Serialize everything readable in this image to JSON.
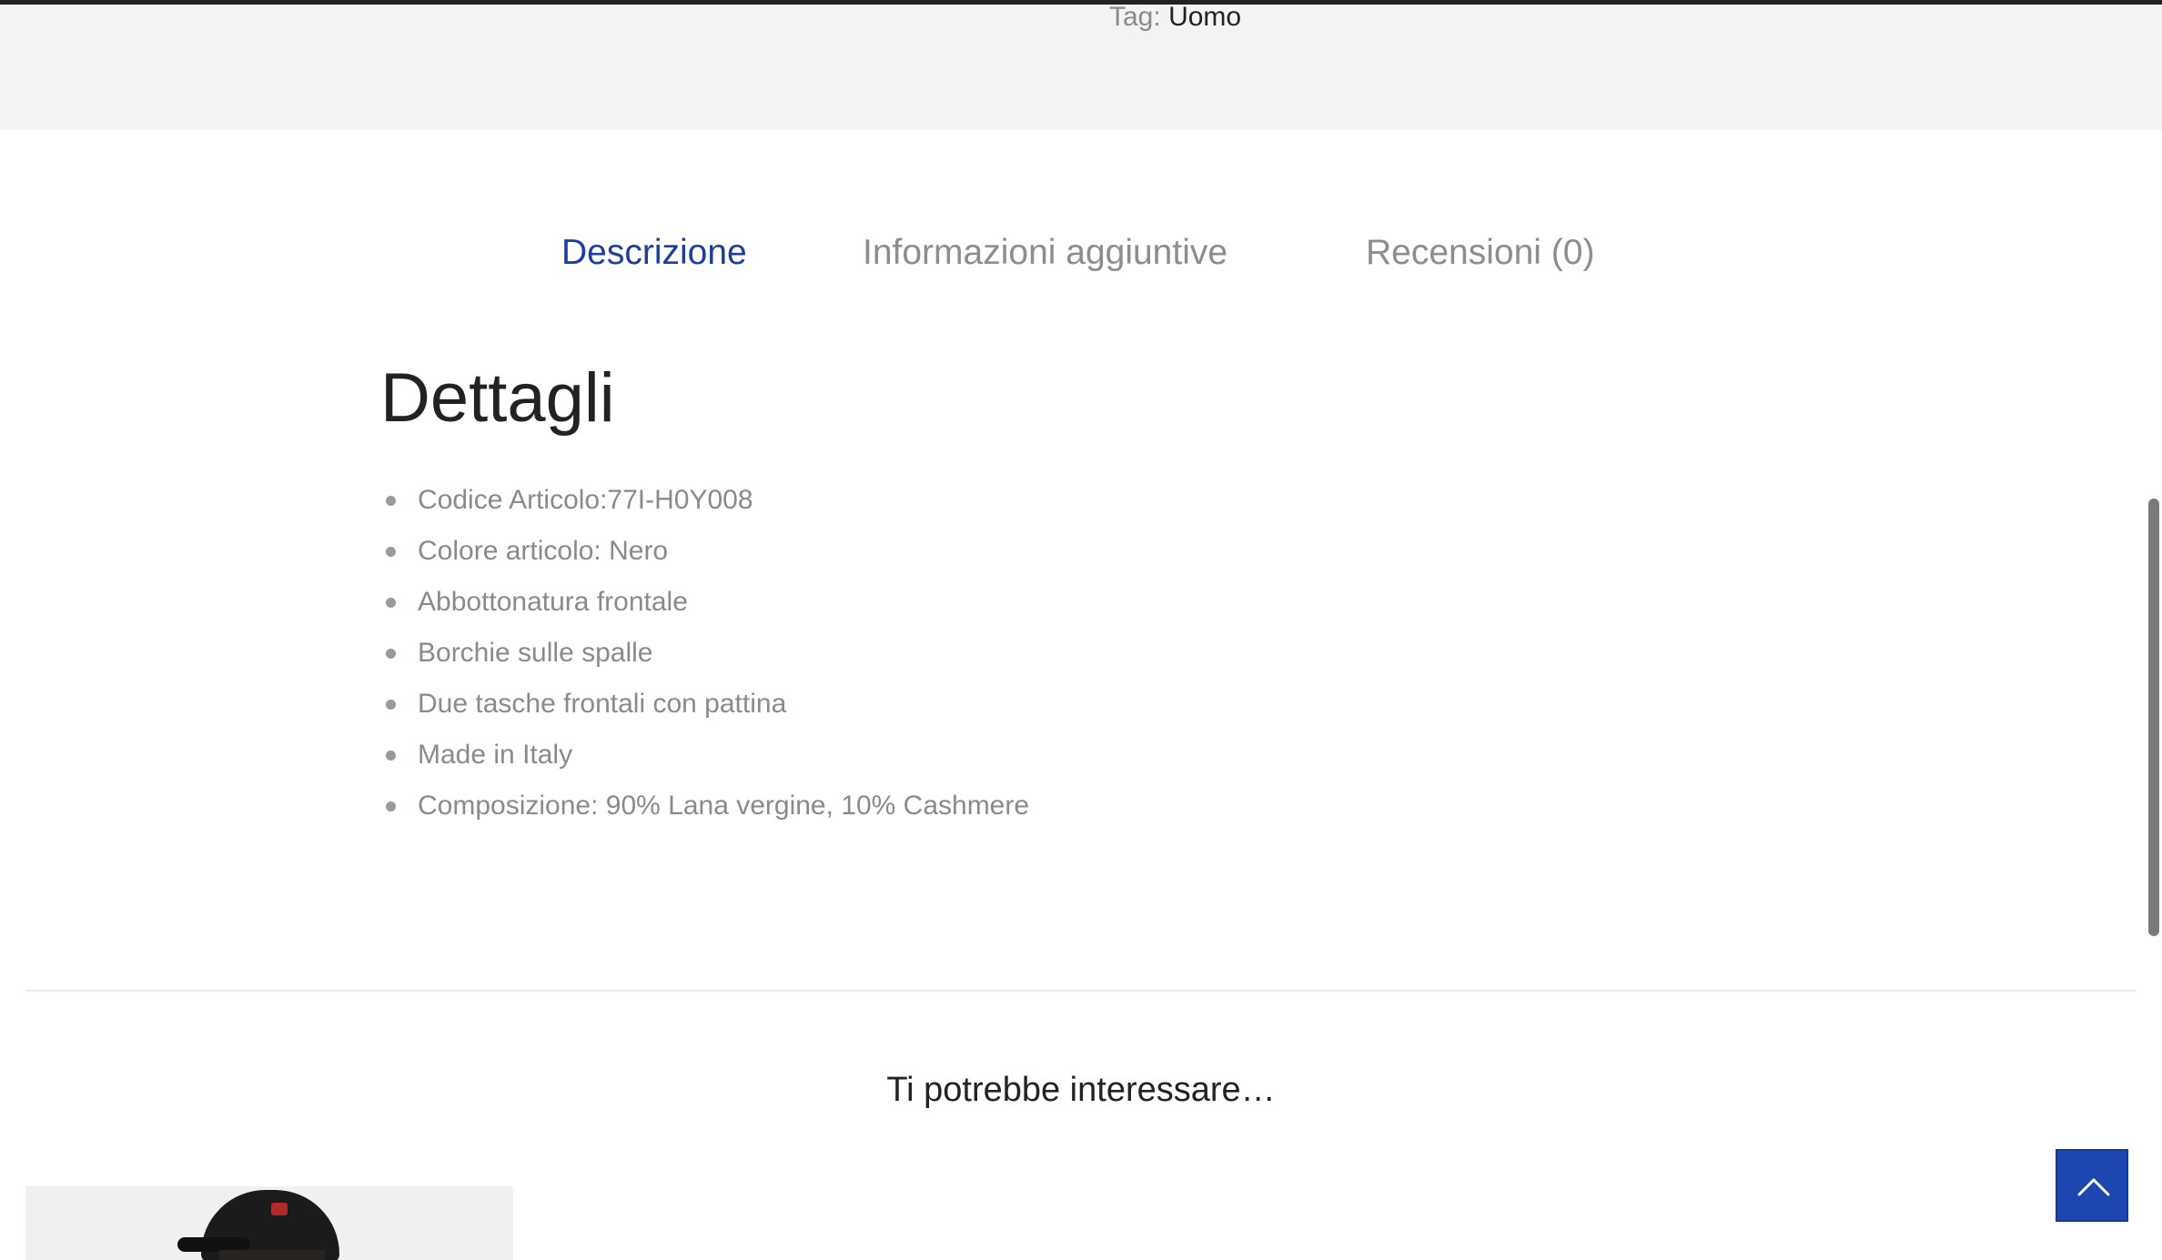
{
  "meta": {
    "tag_label": "Tag:",
    "tag_value": "Uomo"
  },
  "tabs": [
    {
      "label": "Descrizione",
      "active": true
    },
    {
      "label": "Informazioni aggiuntive",
      "active": false
    },
    {
      "label": "Recensioni (0)",
      "active": false
    }
  ],
  "description": {
    "title": "Dettagli",
    "items": [
      "Codice Articolo:77I-H0Y008",
      "Colore articolo: Nero",
      "Abbottonatura frontale",
      "Borchie sulle spalle",
      "Due tasche frontali con pattina",
      "Made in Italy",
      "Composizione: 90% Lana vergine, 10% Cashmere"
    ]
  },
  "related": {
    "title": "Ti potrebbe interessare…"
  },
  "icons": {
    "back_to_top": "chevron-up-icon",
    "bullet": "bullet-dot-icon"
  },
  "colors": {
    "accent": "#1d3f9c",
    "back_to_top_bg": "#1d46b0",
    "muted_text": "#8a8a8a",
    "dark_text": "#222222",
    "band_bg": "#f3f3f3"
  }
}
